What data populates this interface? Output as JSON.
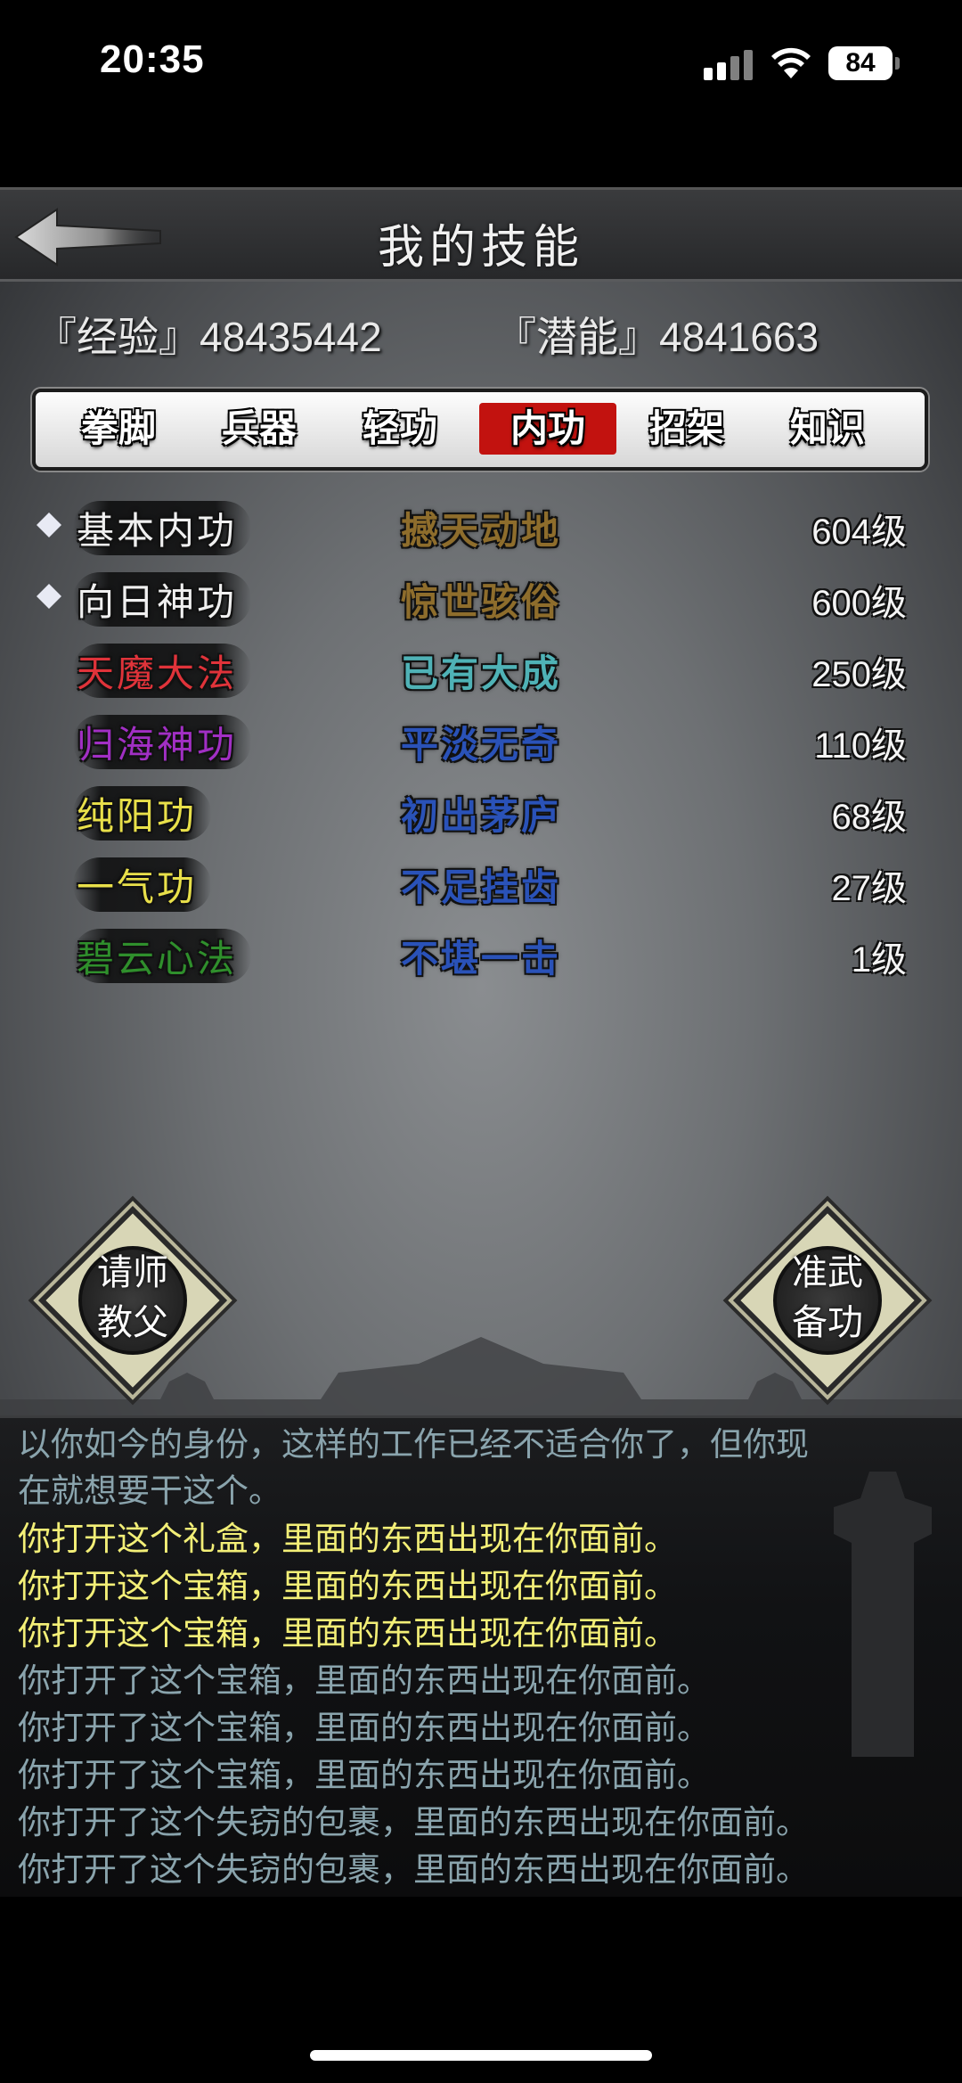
{
  "status_bar": {
    "time": "20:35",
    "battery": "84",
    "icons": [
      "cellular-signal-icon",
      "wifi-icon",
      "battery-icon"
    ]
  },
  "header": {
    "title": "我的技能",
    "back_icon": "back-arrow-icon"
  },
  "stats": {
    "exp": "『经验』48435442",
    "potential": "『潜能』4841663"
  },
  "tabs": [
    {
      "label": "拳脚",
      "active": false
    },
    {
      "label": "兵器",
      "active": false
    },
    {
      "label": "轻功",
      "active": false
    },
    {
      "label": "内功",
      "active": true
    },
    {
      "label": "招架",
      "active": false
    },
    {
      "label": "知识",
      "active": false
    }
  ],
  "skills": [
    {
      "name": "基本内功",
      "rank": "撼天动地",
      "level": "604级",
      "bullet": true,
      "name_color": "#f0f0f0",
      "rank_color": "#8e6d2c"
    },
    {
      "name": "向日神功",
      "rank": "惊世骇俗",
      "level": "600级",
      "bullet": true,
      "name_color": "#f0f0f0",
      "rank_color": "#8e6d2c"
    },
    {
      "name": "天魔大法",
      "rank": "已有大成",
      "level": "250级",
      "bullet": false,
      "name_color": "#e0333a",
      "rank_color": "#4fb2b6"
    },
    {
      "name": "归海神功",
      "rank": "平淡无奇",
      "level": "110级",
      "bullet": false,
      "name_color": "#a12fc4",
      "rank_color": "#2a52b8"
    },
    {
      "name": "纯阳功",
      "rank": "初出茅庐",
      "level": "68级",
      "bullet": false,
      "name_color": "#e9e04a",
      "rank_color": "#2a52b8"
    },
    {
      "name": "一气功",
      "rank": "不足挂齿",
      "level": "27级",
      "bullet": false,
      "name_color": "#e9e04a",
      "rank_color": "#2a52b8"
    },
    {
      "name": "碧云心法",
      "rank": "不堪一击",
      "level": "1级",
      "bullet": false,
      "name_color": "#2f8f2c",
      "rank_color": "#2a52b8"
    }
  ],
  "buttons": {
    "left": {
      "line1": "请师",
      "line2": "教父"
    },
    "right": {
      "line1": "准武",
      "line2": "备功"
    }
  },
  "log": [
    {
      "text": "以你如今的身份，这样的工作已经不适合你了，但你现",
      "color": "gray"
    },
    {
      "text": "在就想要干这个。",
      "color": "gray"
    },
    {
      "text": "你打开这个礼盒，里面的东西出现在你面前。",
      "color": "yellow"
    },
    {
      "text": "你打开这个宝箱，里面的东西出现在你面前。",
      "color": "yellow"
    },
    {
      "text": "你打开这个宝箱，里面的东西出现在你面前。",
      "color": "yellow"
    },
    {
      "text": "你打开了这个宝箱，里面的东西出现在你面前。",
      "color": "gray"
    },
    {
      "text": "你打开了这个宝箱，里面的东西出现在你面前。",
      "color": "gray"
    },
    {
      "text": "你打开了这个宝箱，里面的东西出现在你面前。",
      "color": "gray"
    },
    {
      "text": "你打开了这个失窃的包裹，里面的东西出现在你面前。",
      "color": "gray"
    },
    {
      "text": "你打开了这个失窃的包裹，里面的东西出现在你面前。",
      "color": "gray"
    }
  ]
}
